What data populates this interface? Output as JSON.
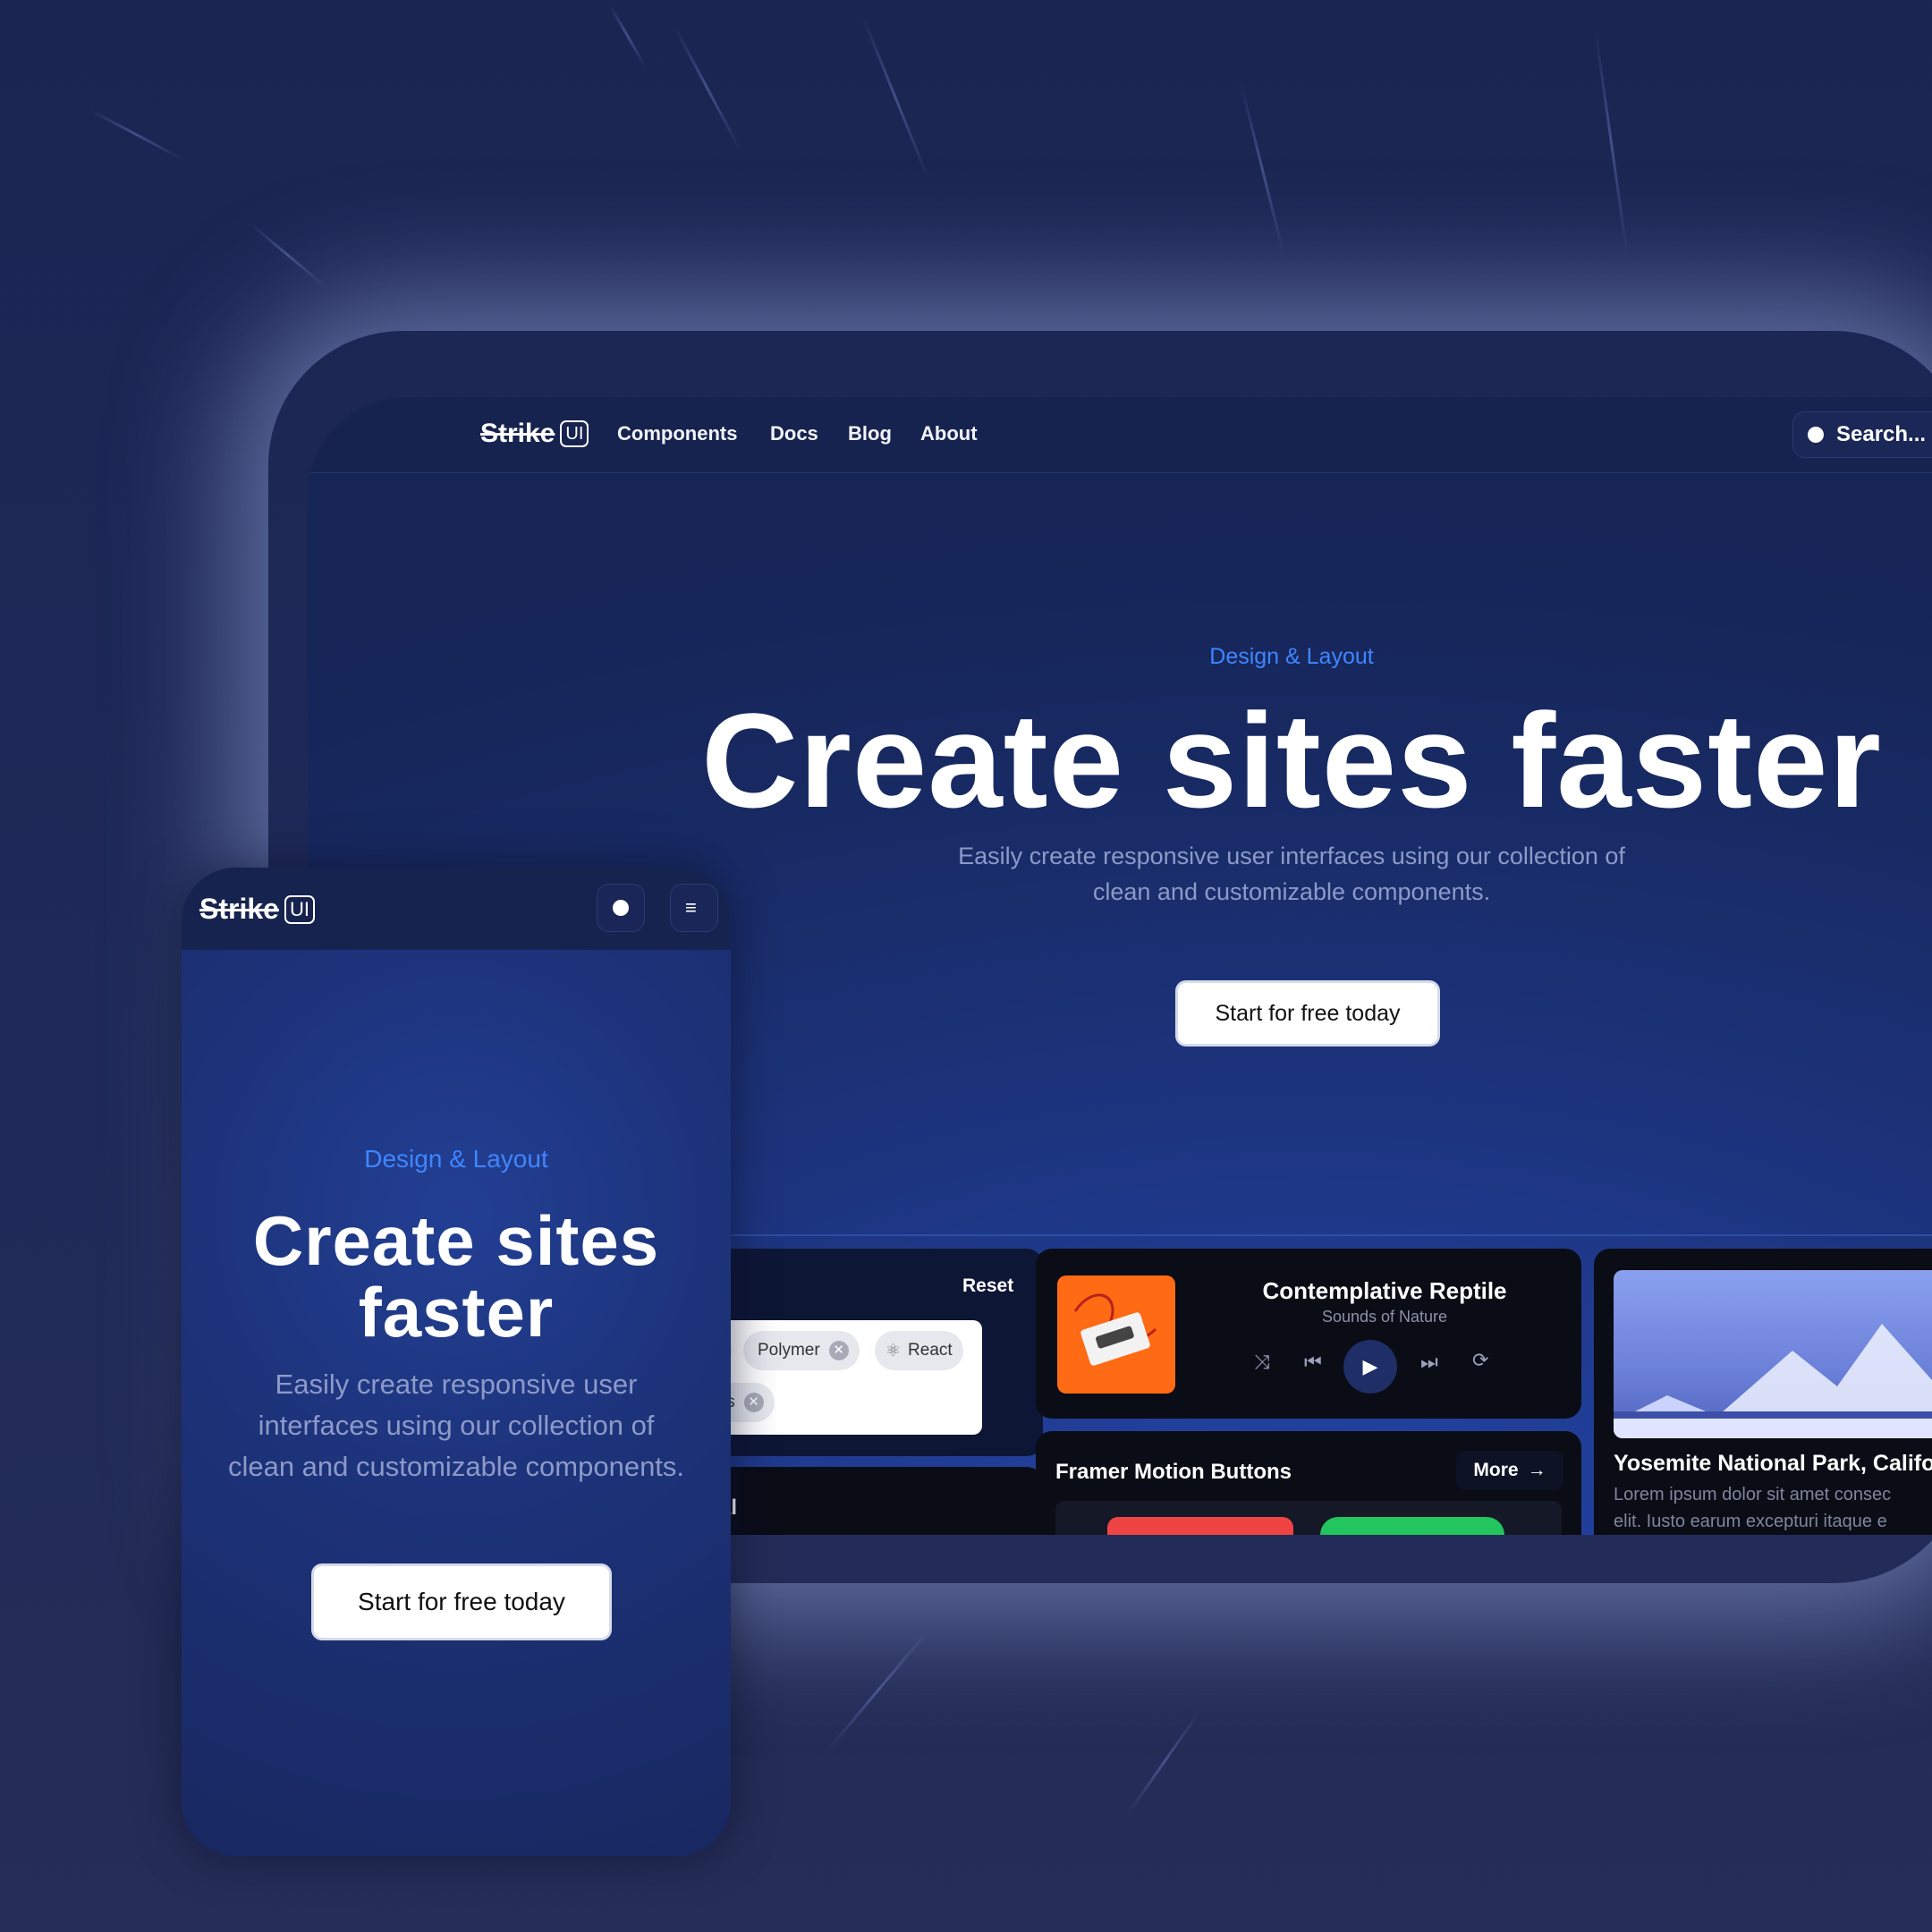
{
  "brand": {
    "name": "Strike",
    "tag": "UI"
  },
  "nav": {
    "links": [
      "Components",
      "Docs",
      "Blog",
      "About"
    ],
    "search_label": "Search..."
  },
  "hero": {
    "eyebrow": "Design & Layout",
    "title": "Create sites faster",
    "subtitle_line1": "Easily create responsive user interfaces using our collection of",
    "subtitle_line2": "clean and customizable components.",
    "cta": "Start for free today"
  },
  "cards": {
    "chips": {
      "reset_label": "Reset",
      "items": [
        "Polymer",
        "React",
        "e.js"
      ],
      "bottom_title": "tal"
    },
    "player": {
      "title": "Contemplative Reptile",
      "subtitle": "Sounds of Nature"
    },
    "framer": {
      "title": "Framer Motion Buttons",
      "more_label": "More"
    },
    "park": {
      "title": "Yosemite National Park, Califo",
      "text_line1": "Lorem ipsum dolor sit amet consec",
      "text_line2": "elit. Iusto earum excepturi itaque e"
    }
  },
  "mobile": {
    "eyebrow": "Design & Layout",
    "title_line1": "Create sites",
    "title_line2": "faster",
    "subtitle_line1": "Easily create responsive user",
    "subtitle_line2": "interfaces using our collection of",
    "subtitle_line3": "clean and customizable components.",
    "cta": "Start for free today"
  },
  "colors": {
    "accent": "#3f86ff",
    "background": "#1b2552",
    "play_red": "#ef4444",
    "play_green": "#22c55e"
  }
}
